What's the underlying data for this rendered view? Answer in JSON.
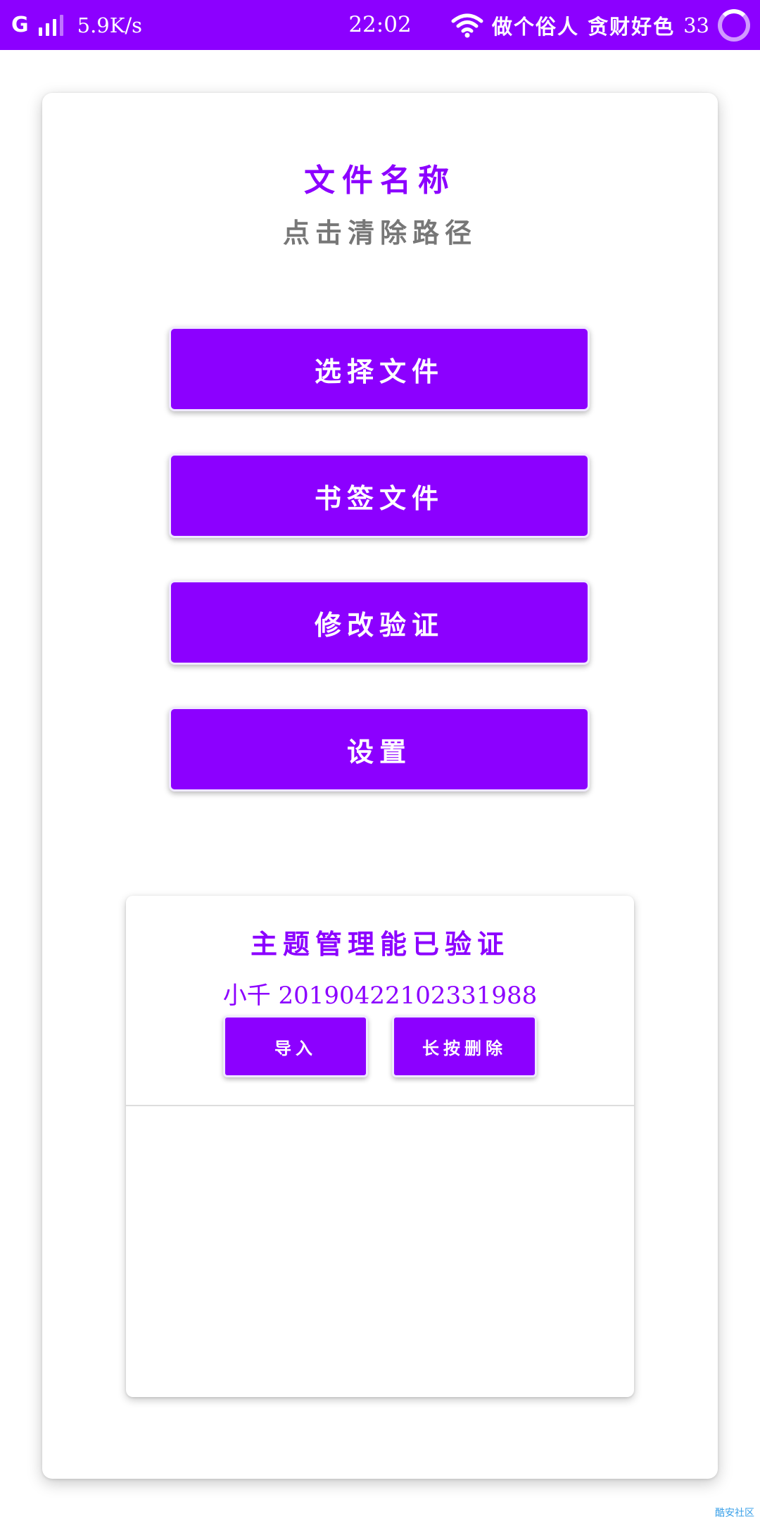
{
  "status_bar": {
    "carrier": "G",
    "net_speed": "5.9K/s",
    "time": "22:02",
    "right_text": "做个俗人 贪财好色",
    "battery_level": "33"
  },
  "header": {
    "file_name": "文件名称",
    "clear_path": "点击清除路径"
  },
  "actions": {
    "select_file": "选择文件",
    "bookmark_file": "书签文件",
    "modify_verify": "修改验证",
    "settings": "设置"
  },
  "theme_card": {
    "title": "主题管理能已验证",
    "user_id": "小千 201904221023319​88",
    "import_label": "导入",
    "long_press_delete_label": "长按删除",
    "items": []
  },
  "watermark": "酷安社区",
  "colors": {
    "accent": "#8c00ff",
    "subtitle": "#777777",
    "watermark": "#3aa0e8"
  }
}
